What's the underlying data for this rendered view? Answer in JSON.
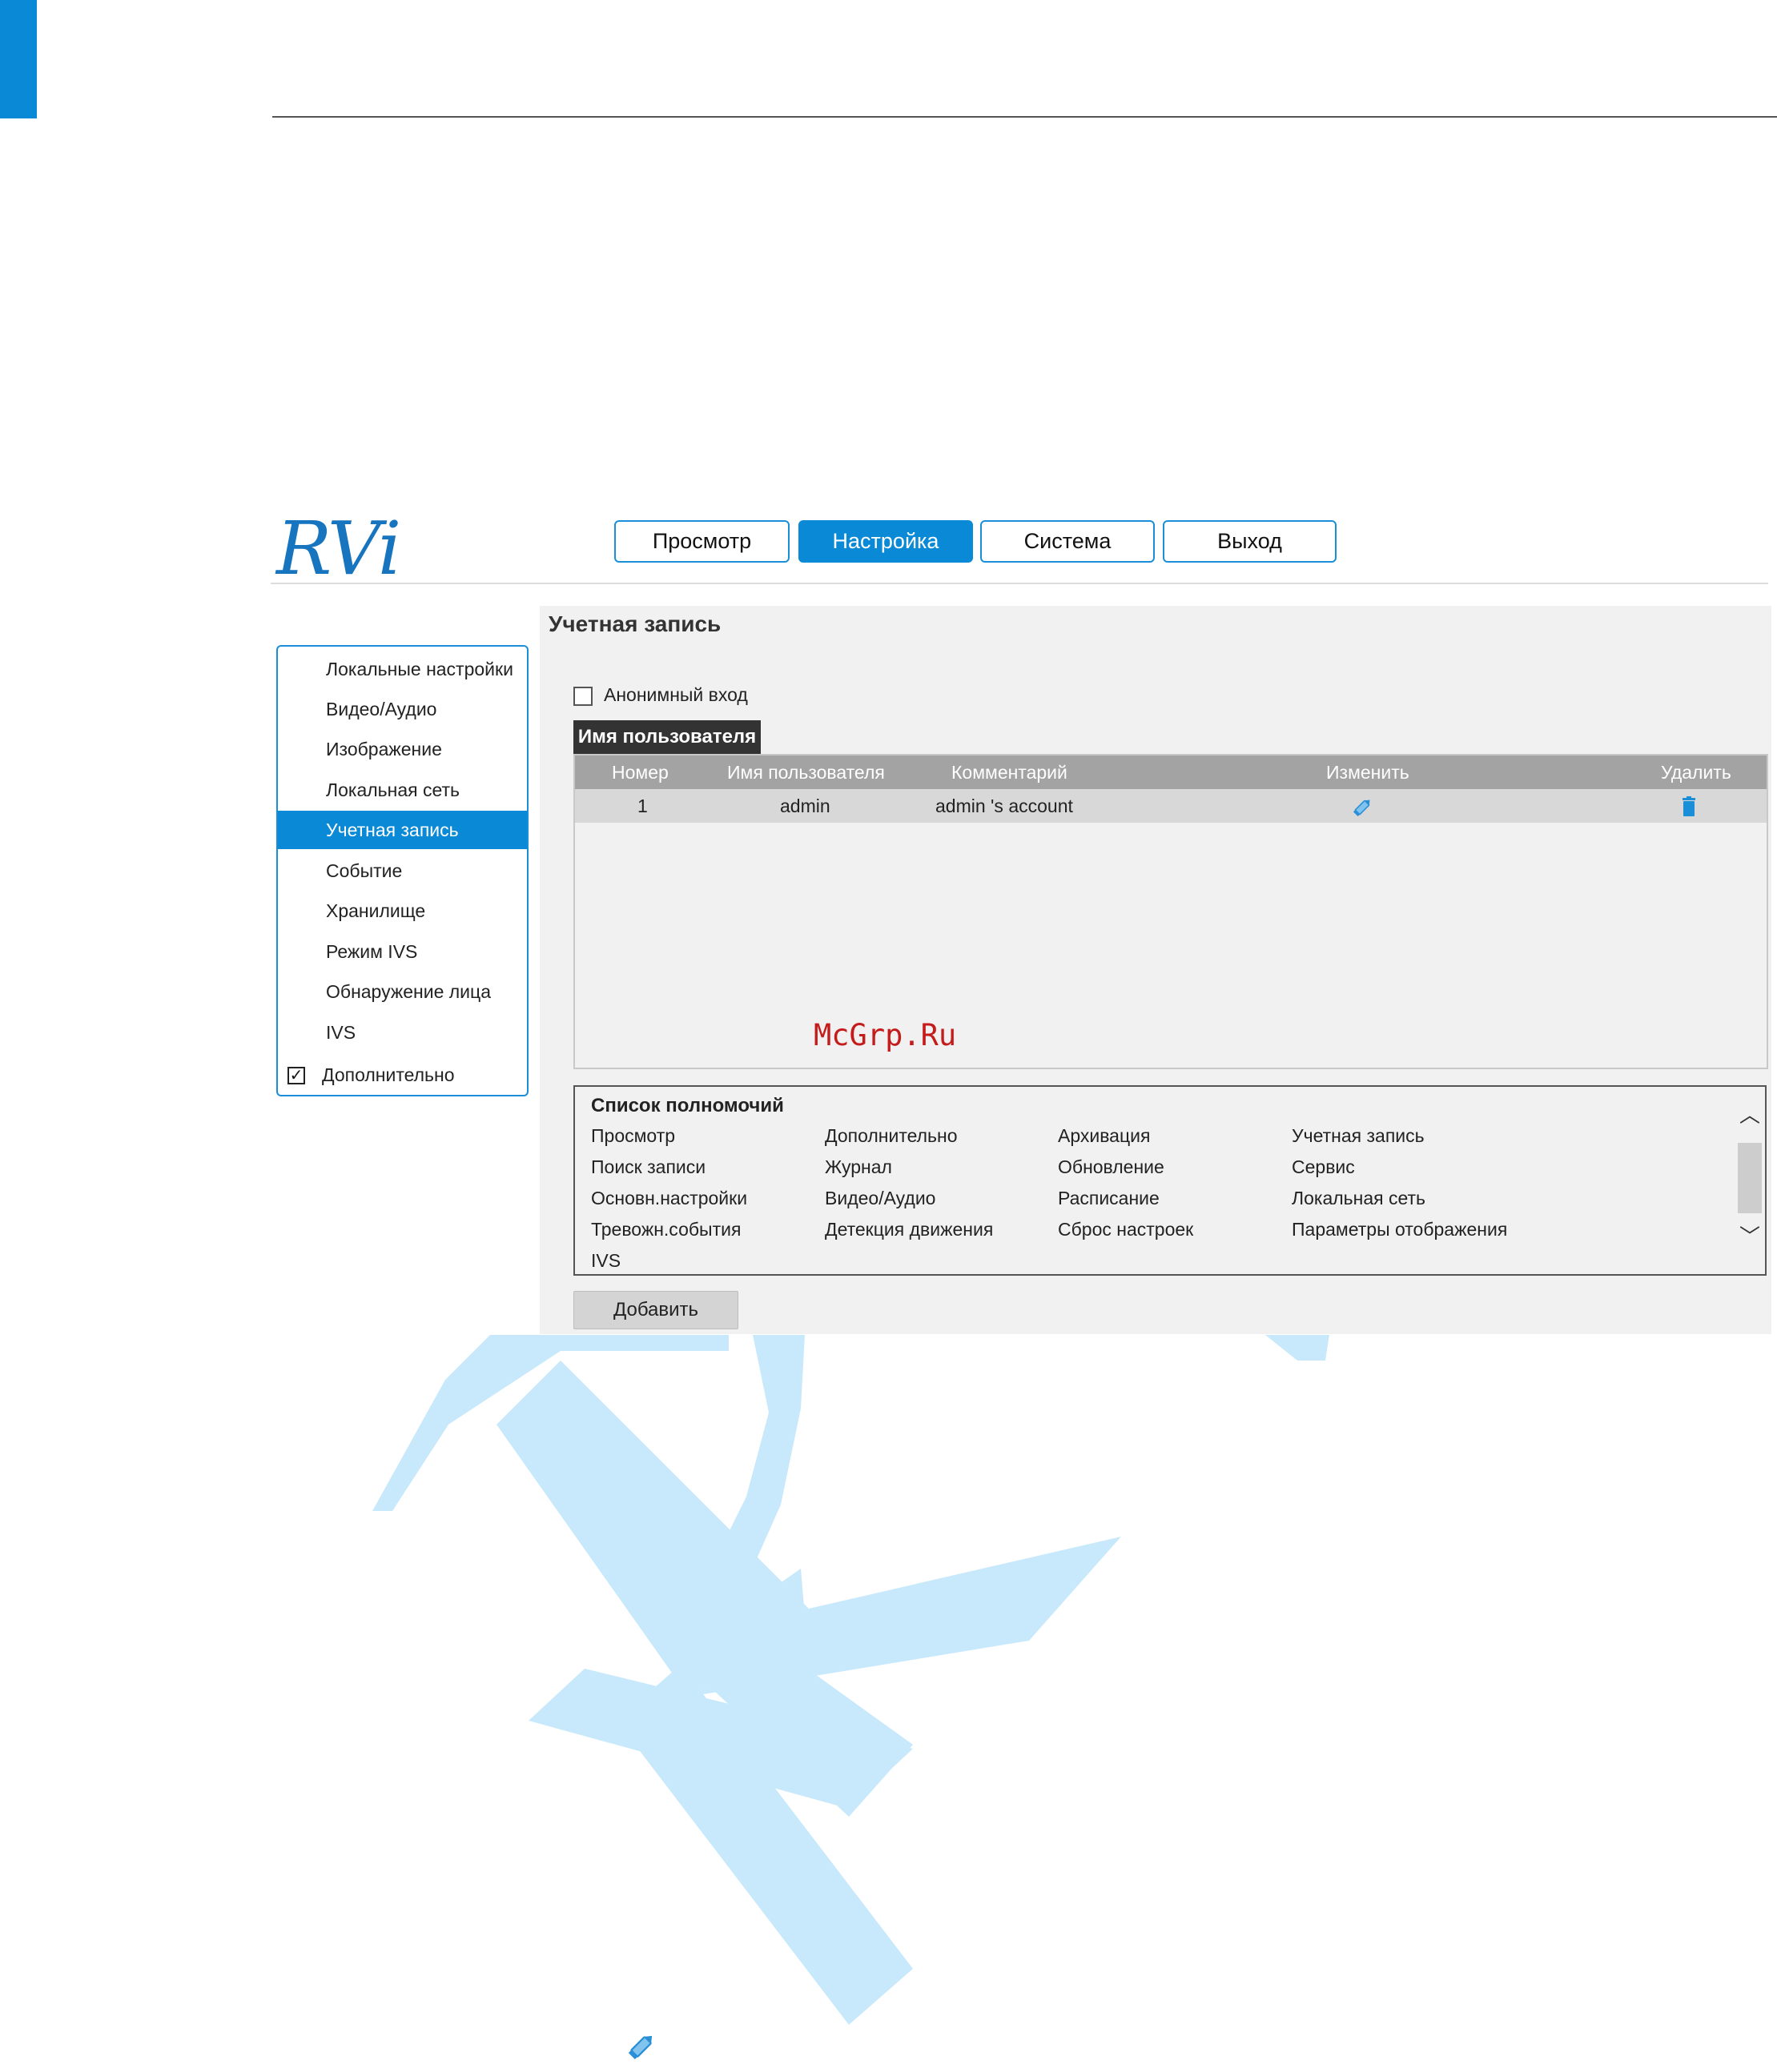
{
  "header": {
    "logo": "RVi",
    "nav": [
      "Просмотр",
      "Настройка",
      "Система",
      "Выход"
    ],
    "active_nav": "Настройка"
  },
  "menu": {
    "items": [
      "Локальные настройки",
      "Видео/Аудио",
      "Изображение",
      "Локальная сеть",
      "Учетная запись",
      "Событие",
      "Хранилище",
      "Режим IVS",
      "Обнаружение лица",
      "IVS"
    ],
    "active": "Учетная запись",
    "advanced_label": "Дополнительно",
    "advanced_checked": true
  },
  "account": {
    "title": "Учетная запись",
    "anonymous_label": "Анонимный вход",
    "anonymous_checked": false,
    "tab_label": "Имя пользователя",
    "columns": [
      "Номер",
      "Имя пользователя",
      "Комментарий",
      "Изменить",
      "Удалить"
    ],
    "rows": [
      {
        "number": "1",
        "username": "admin",
        "comment": "admin 's account",
        "edit_icon": "pencil-icon",
        "delete_icon": "trash-icon"
      }
    ],
    "watermark_text": "McGrp.Ru"
  },
  "permissions": {
    "title": "Список полномочий",
    "items": [
      "Просмотр",
      "Дополнительно",
      "Архивация",
      "Учетная запись",
      "Поиск записи",
      "Журнал",
      "Обновление",
      "Сервис",
      "Основн.настройки",
      "Видео/Аудио",
      "Расписание",
      "Локальная сеть",
      "Тревожн.события",
      "Детекция движения",
      "Сброс настроек",
      "Параметры отображения",
      "IVS"
    ]
  },
  "buttons": {
    "add": "Добавить"
  },
  "colors": {
    "accent": "#0a8ad6",
    "watermark": "#c8e9fb"
  },
  "footer_icon": "pencil-icon"
}
